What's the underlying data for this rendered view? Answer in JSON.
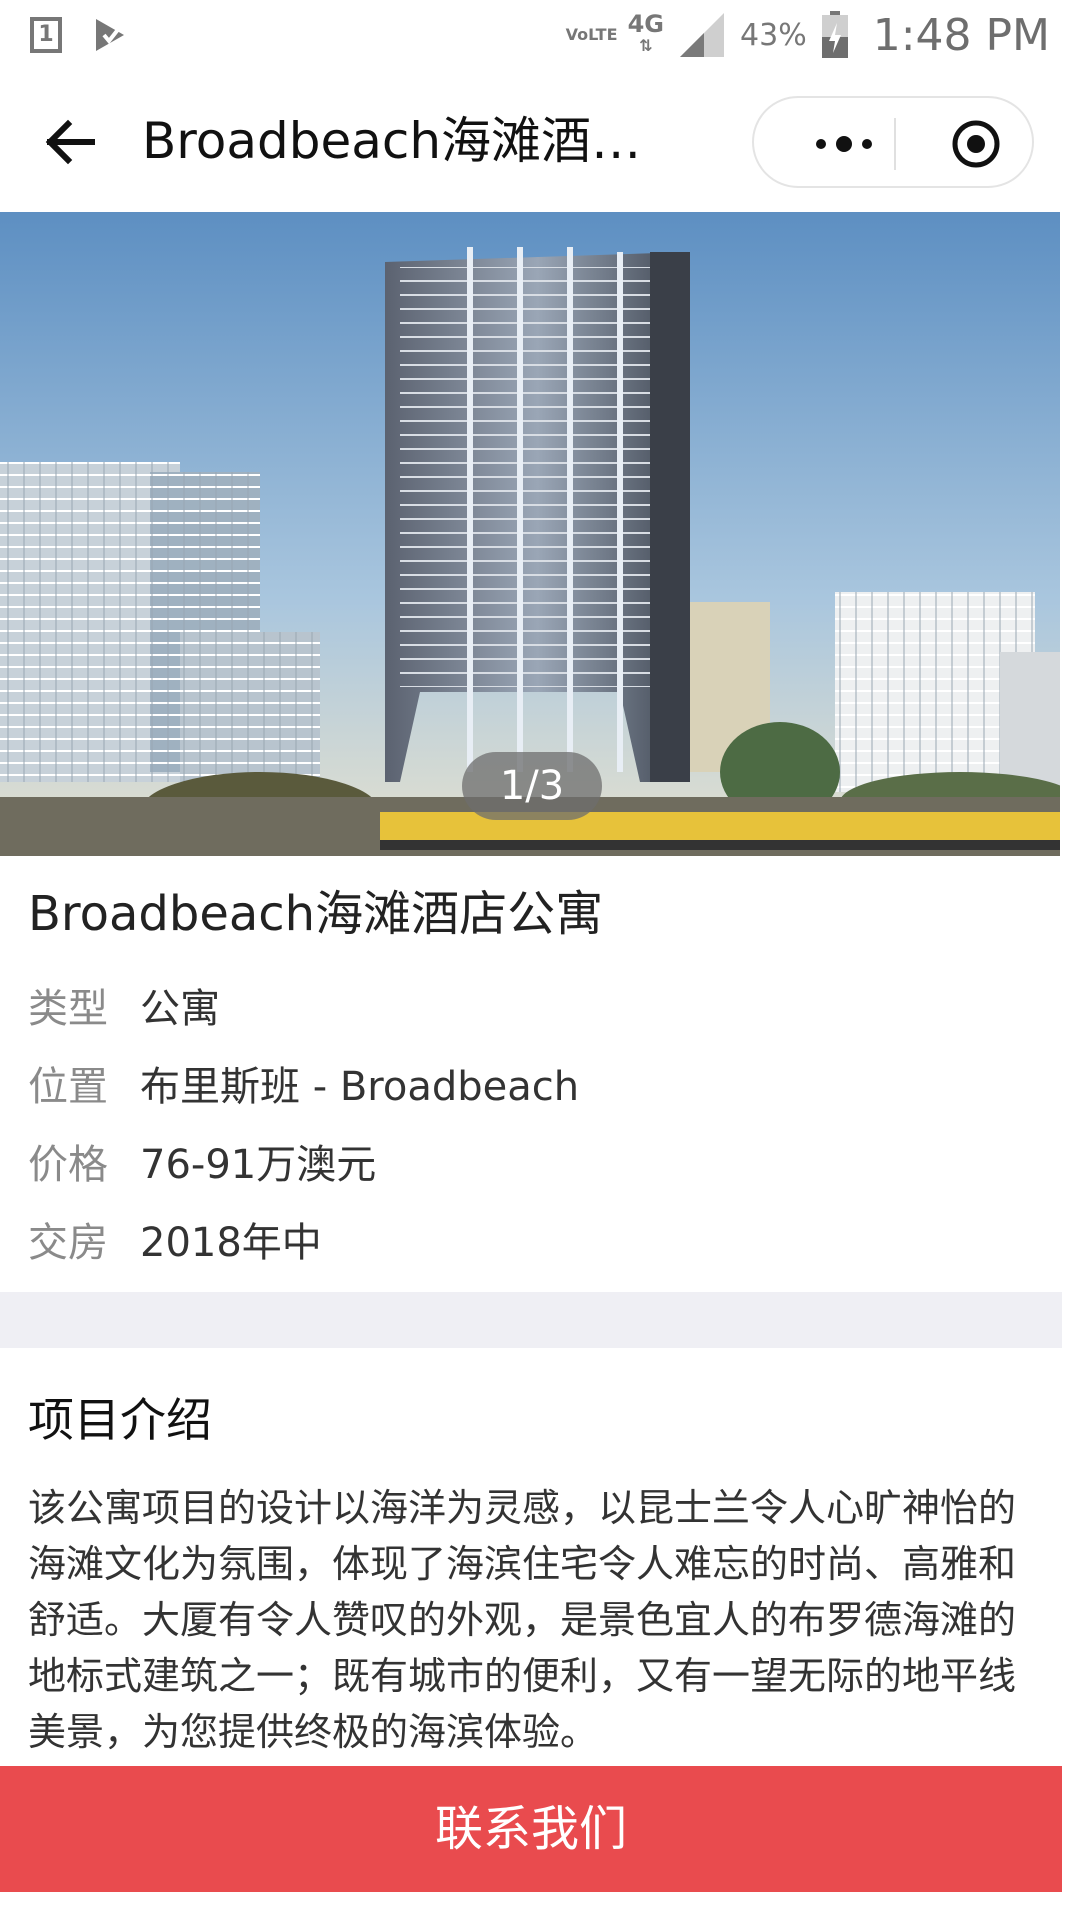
{
  "status_bar": {
    "sim_slot": "1",
    "volte": "VoLTE",
    "network": "4G",
    "battery": "43%",
    "time": "1:48 PM"
  },
  "nav": {
    "title": "Broadbeach海滩酒店…",
    "back_icon": "arrow-left-icon",
    "more_icon": "more-dots-icon",
    "close_icon": "target-close-icon"
  },
  "carousel": {
    "indicator": "1/3",
    "current": 1,
    "total": 3
  },
  "property": {
    "name": "Broadbeach海滩酒店公寓",
    "details": [
      {
        "label": "类型",
        "value": "公寓"
      },
      {
        "label": "位置",
        "value": "布里斯班 - Broadbeach"
      },
      {
        "label": "价格",
        "value": "76-91万澳元"
      },
      {
        "label": "交房",
        "value": "2018年中"
      }
    ]
  },
  "intro": {
    "heading": "项目介绍",
    "text": "该公寓项目的设计以海洋为灵感，以昆士兰令人心旷神怡的海滩文化为氛围，体现了海滨住宅令人难忘的时尚、高雅和舒适。大厦有令人赞叹的外观，是景色宜人的布罗德海滩的地标式建筑之一；既有城市的便利，又有一望无际的地平线美景，为您提供终极的海滨体验。"
  },
  "footer": {
    "contact_label": "联系我们"
  },
  "colors": {
    "contact_button": "#e94b4e",
    "divider": "#efeff4"
  }
}
